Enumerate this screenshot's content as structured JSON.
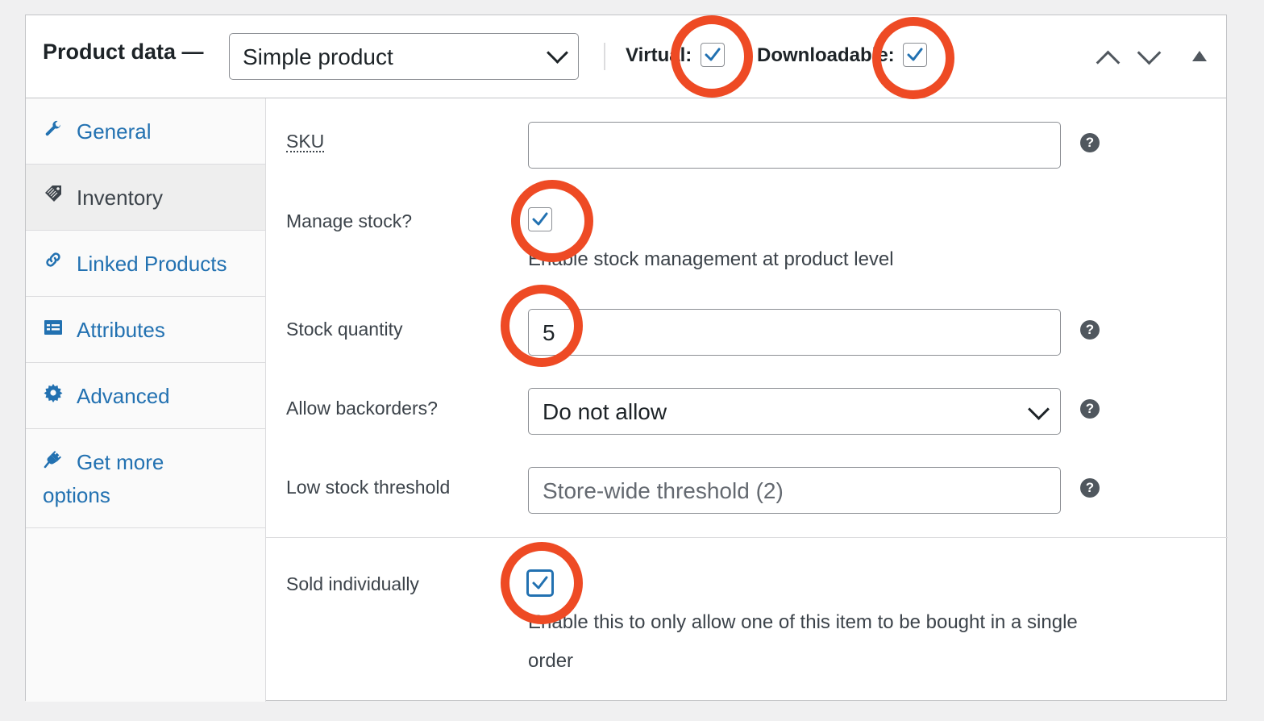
{
  "header": {
    "title": "Product data —",
    "product_type": "Simple product",
    "virtual_label": "Virtual:",
    "virtual_checked": true,
    "downloadable_label": "Downloadable:",
    "downloadable_checked": true,
    "controls": [
      "move-up-icon",
      "move-down-icon",
      "collapse-toggle-icon"
    ]
  },
  "sidebar": {
    "items": [
      {
        "label": "General",
        "icon": "wrench-icon",
        "active": false
      },
      {
        "label": "Inventory",
        "icon": "tag-icon",
        "active": true
      },
      {
        "label": "Linked Products",
        "icon": "link-icon",
        "active": false
      },
      {
        "label": "Attributes",
        "icon": "list-icon",
        "active": false
      },
      {
        "label": "Advanced",
        "icon": "gear-icon",
        "active": false
      },
      {
        "label_line1": "Get more",
        "label_line2": "options",
        "icon": "plugin-icon",
        "active": false
      }
    ]
  },
  "inventory": {
    "sku": {
      "label": "SKU",
      "value": ""
    },
    "manage_stock": {
      "label": "Manage stock?",
      "checked": true,
      "description": "Enable stock management at product level"
    },
    "stock_quantity": {
      "label": "Stock quantity",
      "value": "5"
    },
    "backorders": {
      "label": "Allow backorders?",
      "value": "Do not allow"
    },
    "low_stock": {
      "label": "Low stock threshold",
      "placeholder": "Store-wide threshold (2)"
    },
    "sold_individually": {
      "label": "Sold individually",
      "checked": true,
      "description_line1": "Enable this to only allow one of this item to be bought in a single",
      "description_line2": "order"
    }
  },
  "colors": {
    "accent": "#2271b1",
    "annotation": "#ee4a24"
  }
}
